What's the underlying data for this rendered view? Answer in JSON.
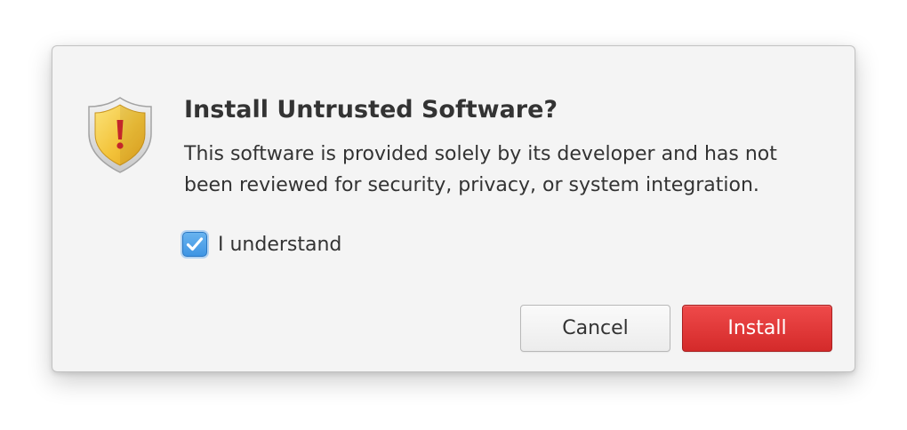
{
  "dialog": {
    "title": "Install Untrusted Software?",
    "message": "This software is provided solely by its developer and has not been reviewed for security, privacy, or system integration.",
    "icon": "security-warning-shield-icon",
    "checkbox": {
      "label": "I understand",
      "checked": true
    },
    "buttons": {
      "cancel_label": "Cancel",
      "install_label": "Install"
    }
  },
  "colors": {
    "accent_check": "#4a9fe8",
    "destructive": "#dc3131",
    "shield_yellow": "#f5c842",
    "exclamation": "#c3262b"
  }
}
